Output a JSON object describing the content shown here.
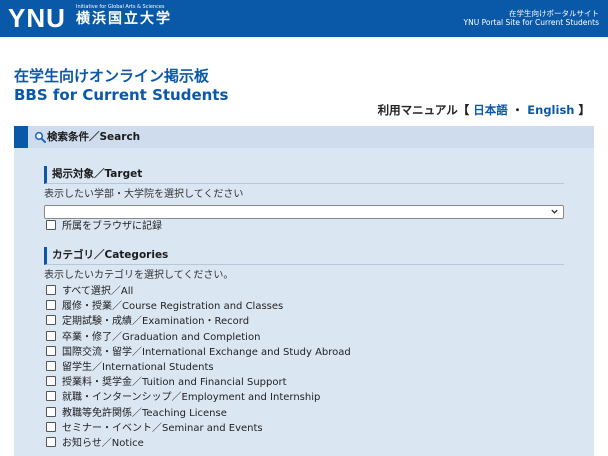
{
  "header": {
    "logo_text": "YNU",
    "logo_tagline": "Initiative for Global Arts & Sciences",
    "logo_japanese": "横浜国立大学",
    "portal_jp": "在学生向けポータルサイト",
    "portal_en": "YNU Portal Site for Current Students",
    "bg_color": "#0a58a8"
  },
  "page": {
    "title_jp": "在学生向けオンライン掲示板",
    "title_en": "BBS for Current Students"
  },
  "manual": {
    "prefix": "利用マニュアル【",
    "japanese": "日本語",
    "separator": "・",
    "english": "English",
    "suffix": "】"
  },
  "search": {
    "label": "検索条件／Search",
    "icon": "search-icon",
    "panel_color": "#dbe6f3"
  },
  "target": {
    "heading": "掲示対象／Target",
    "hint": "表示したい学部・大学院を選択してください",
    "select_value": "",
    "remember_label": "所属をブラウザに記録"
  },
  "categories": {
    "heading": "カテゴリ／Categories",
    "hint": "表示したいカテゴリを選択してください。",
    "items": [
      "すべて選択／All",
      "履修・授業／Course Registration and Classes",
      "定期試験・成績／Examination・Record",
      "卒業・修了／Graduation and Completion",
      "国際交流・留学／International Exchange and Study Abroad",
      "留学生／International Students",
      "授業料・奨学金／Tuition and Financial Support",
      "就職・インターンシップ／Employment and Internship",
      "教職等免許関係／Teaching License",
      "セミナー・イベント／Seminar and Events",
      "お知らせ／Notice"
    ]
  }
}
